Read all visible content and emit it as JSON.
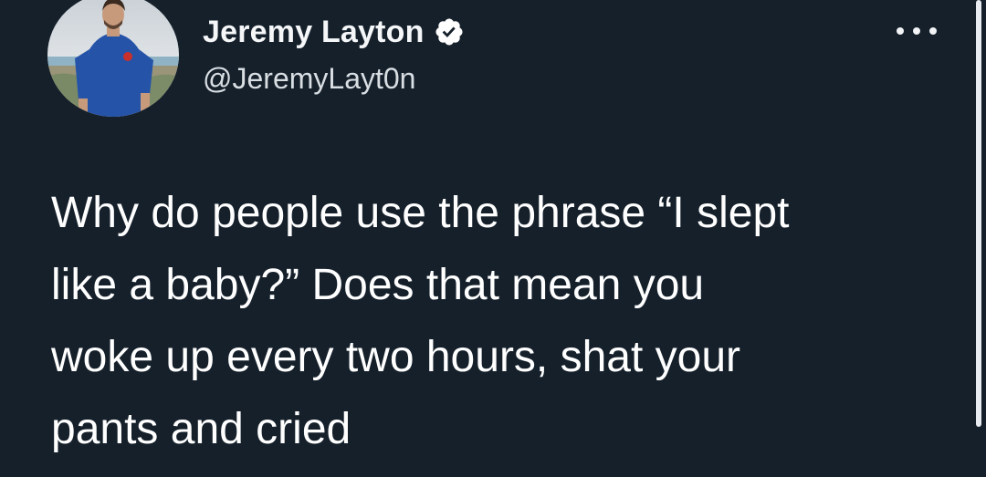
{
  "tweet": {
    "author": {
      "display_name": "Jeremy Layton",
      "handle": "@JeremyLayt0n",
      "verified": true,
      "avatar_icon": "profile-photo"
    },
    "more_menu_icon": "ellipsis-icon",
    "text_lines": [
      "Why do people use the phrase “I slept",
      "like a baby?” Does that mean you",
      "woke up every two hours, shat your",
      "pants and cried"
    ]
  },
  "colors": {
    "background": "#15202b",
    "text": "#ffffff",
    "verified_badge": "#ffffff"
  }
}
